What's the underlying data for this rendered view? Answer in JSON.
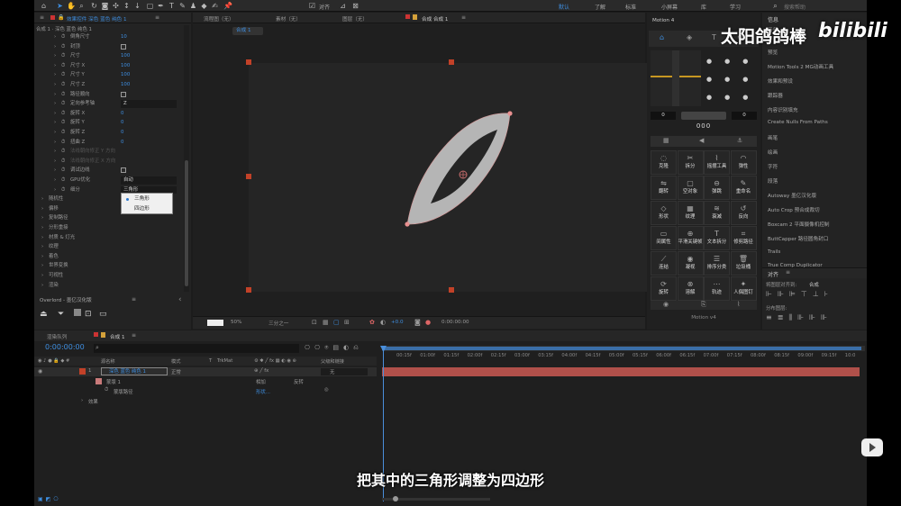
{
  "overlay": {
    "watermark": "太阳鸽鸽棒",
    "bilibili": "bilibili",
    "subtitle": "把其中的三角形调整为四边形"
  },
  "topbar": {
    "snap_label": "对齐",
    "workspaces": [
      "默认",
      "了解",
      "标准",
      "小屏幕",
      "库",
      "学习"
    ],
    "search_placeholder": "搜索帮助"
  },
  "effects_panel": {
    "title": "效果控件 深色 蓝色 纯色 1",
    "breadcrumb": "合成 1 · 深色 蓝色 纯色 1",
    "rows": [
      {
        "label": "倒角尺寸",
        "value": "10",
        "type": "num"
      },
      {
        "label": "封顶",
        "value": "",
        "type": "check"
      },
      {
        "label": "尺寸",
        "value": "100",
        "type": "num"
      },
      {
        "label": "尺寸 X",
        "value": "100",
        "type": "num"
      },
      {
        "label": "尺寸 Y",
        "value": "100",
        "type": "num"
      },
      {
        "label": "尺寸 Z",
        "value": "100",
        "type": "num"
      },
      {
        "label": "路径顺向",
        "value": "",
        "type": "check"
      },
      {
        "label": "定向参考轴",
        "value": "Z",
        "type": "select"
      },
      {
        "label": "旋转 X",
        "value": "0",
        "type": "num"
      },
      {
        "label": "旋转 Y",
        "value": "0",
        "type": "num"
      },
      {
        "label": "旋转 Z",
        "value": "0",
        "type": "num"
      },
      {
        "label": "扭曲 Z",
        "value": "0",
        "type": "num"
      },
      {
        "label": "法线朝向修正 Y 方向",
        "value": "",
        "type": "dim"
      },
      {
        "label": "法线朝向修正 X 方向",
        "value": "",
        "type": "dim"
      },
      {
        "label": "调试边线",
        "value": "",
        "type": "check"
      },
      {
        "label": "GPU优化",
        "value": "自动",
        "type": "select"
      },
      {
        "label": "细分",
        "value": "三角形",
        "type": "select"
      },
      {
        "label": "随机性",
        "value": "",
        "type": "group"
      },
      {
        "label": "偏移",
        "value": "",
        "type": "group"
      },
      {
        "label": "复制路径",
        "value": "",
        "type": "group"
      },
      {
        "label": "分形重接",
        "value": "",
        "type": "group"
      },
      {
        "label": "材质 & 灯光",
        "value": "",
        "type": "group"
      },
      {
        "label": "纹理",
        "value": "",
        "type": "group"
      },
      {
        "label": "着色",
        "value": "",
        "type": "group"
      },
      {
        "label": "世界变换",
        "value": "",
        "type": "group"
      },
      {
        "label": "可视性",
        "value": "",
        "type": "group"
      },
      {
        "label": "渲染",
        "value": "",
        "type": "group"
      }
    ],
    "dropdown_options": [
      "三角形",
      "四边形"
    ]
  },
  "overlord": {
    "title": "Overlord - 墨亿汉化版"
  },
  "viewer": {
    "tabs": [
      "流程图（无）",
      "素材（无）",
      "图层（无）",
      "合成 合成 1"
    ],
    "comp_tab": "合成 1",
    "zoom": "50%",
    "resolution": "三分之一",
    "exposure": "+0.0",
    "timecode": "0:00:00:00"
  },
  "motion": {
    "title": "Motion 4",
    "val_left": "0",
    "val_right": "0",
    "val_center": "000",
    "version": "Motion v4",
    "buttons": [
      "克隆",
      "拆分",
      "摇摆工具",
      "弹性",
      "翻转",
      "空对象",
      "弹跳",
      "重命名",
      "形状",
      "纹理",
      "衰减",
      "反向",
      "间属性",
      "平滑关键帧",
      "文本拆分",
      "修剪路径",
      "连结",
      "凝视",
      "排序分类",
      "垃圾桶",
      "旋转",
      "溶解",
      "轨迹",
      "人偶图钉"
    ]
  },
  "right_panel": {
    "title": "信息",
    "items": [
      "音频",
      "预览",
      "Motion Tools 2 MG动画工具",
      "效果和预设",
      "跟踪器",
      "内容识别填充",
      "Create Nulls From Paths",
      "画笔",
      "绘画",
      "字符",
      "段落",
      "Autoway 墨亿汉化版",
      "Auto Crop 预合成裁切",
      "Boxcam 2 平面摄像机控制",
      "ButtCapper 路径圆角封口",
      "Trails",
      "True Comp Duplicator"
    ],
    "align_title": "对齐",
    "align_to_label": "将图层对齐到:",
    "align_to_value": "合成",
    "distribute_label": "分布图层:"
  },
  "timeline": {
    "tabs": [
      "渲染队列",
      "合成 1"
    ],
    "timecode": "0:00:00:00",
    "col_headers": [
      "源名称",
      "模式",
      "T",
      "TrkMat",
      "父级和链接"
    ],
    "layer_num": "1",
    "layer_name": "深色 蓝色 纯色 1",
    "layer_mode": "正常",
    "layer_parent": "无",
    "sub_mask": "蒙版 1",
    "mask_mode": "相加",
    "mask_invert": "反转",
    "mask_path": "蒙版路径",
    "mask_shape": "形状...",
    "effects_label": "效果",
    "mode_none": "无",
    "ticks": [
      "00:15f",
      "01:00f",
      "01:15f",
      "02:00f",
      "02:15f",
      "03:00f",
      "03:15f",
      "04:00f",
      "04:15f",
      "05:00f",
      "05:15f",
      "06:00f",
      "06:15f",
      "07:00f",
      "07:15f",
      "08:00f",
      "08:15f",
      "09:00f",
      "09:15f",
      "10:0"
    ]
  },
  "colors": {
    "accent": "#3e8ee0",
    "layer_bar": "#b0504a",
    "handle": "#c24128"
  }
}
